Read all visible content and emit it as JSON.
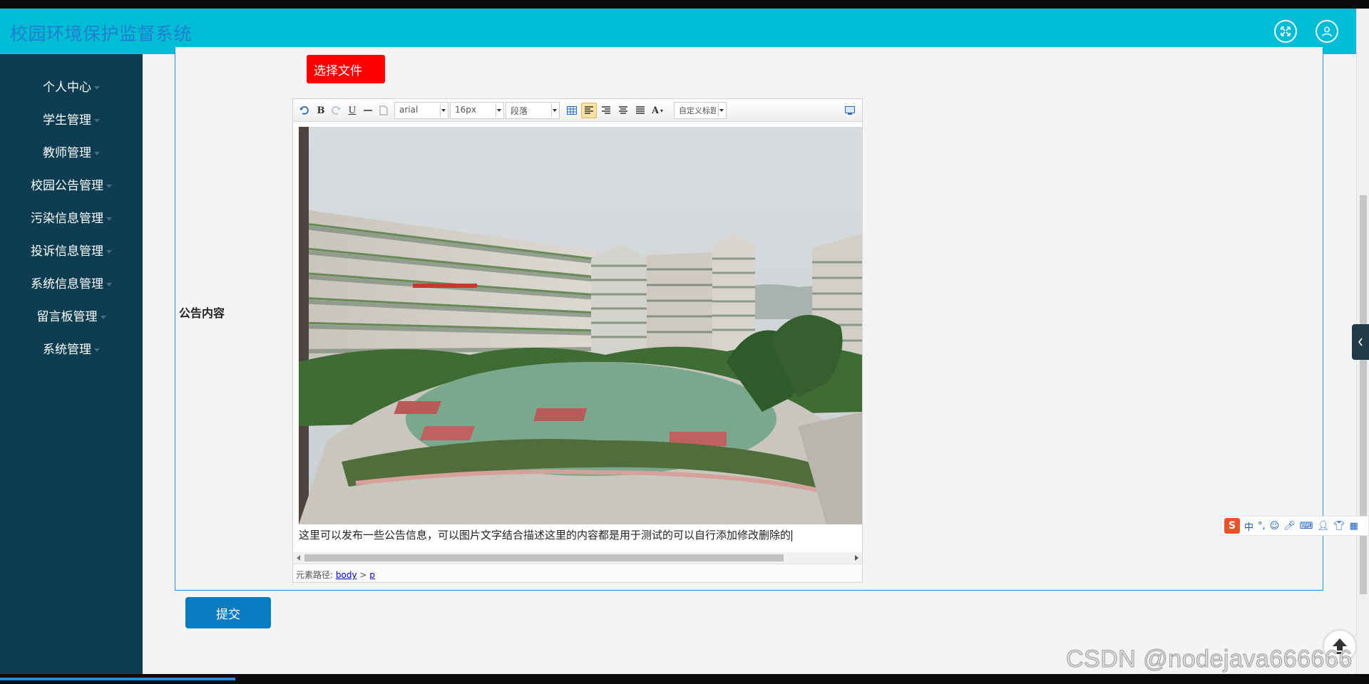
{
  "app": {
    "title": "校园环境保护监督系统"
  },
  "header": {
    "fullscreen_icon": "expand-icon",
    "user_icon": "user-icon"
  },
  "sidebar": {
    "items": [
      {
        "label": "个人中心"
      },
      {
        "label": "学生管理"
      },
      {
        "label": "教师管理"
      },
      {
        "label": "校园公告管理"
      },
      {
        "label": "污染信息管理"
      },
      {
        "label": "投诉信息管理"
      },
      {
        "label": "系统信息管理"
      },
      {
        "label": "留言板管理"
      },
      {
        "label": "系统管理"
      }
    ]
  },
  "form": {
    "file_button": "选择文件",
    "content_label": "公告内容",
    "submit_label": "提交"
  },
  "editor": {
    "font_family": "arial",
    "font_size": "16px",
    "paragraph": "段落",
    "custom_title": "自定义标题",
    "content_text": "这里可以发布一些公告信息，可以图片文字结合描述这里的内容都是用于测试的可以自行添加修改删除的",
    "path_label": "元素路径:",
    "path_body": "body",
    "path_sep": ">",
    "path_p": "p"
  },
  "watermark": "CSDN @nodejava666666",
  "ime": {
    "mode": "中"
  },
  "colors": {
    "header": "#00bcd4",
    "sidebar": "#0e3d52",
    "file_button": "#ff0000",
    "submit_button": "#0a7bc0",
    "title_text": "#1f7fd0"
  }
}
